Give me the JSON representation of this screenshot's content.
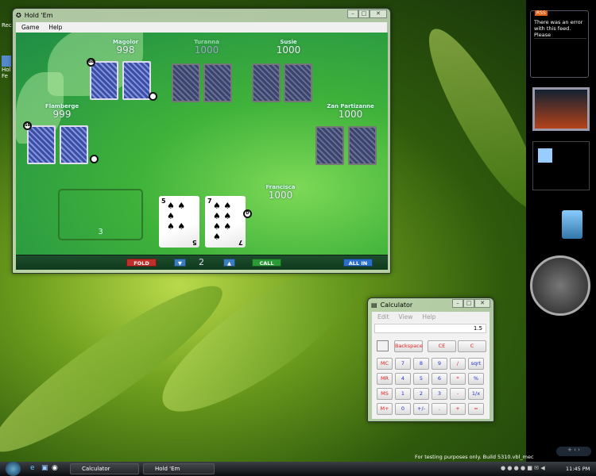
{
  "desktop": {
    "icons": [
      {
        "label": "Rec"
      },
      {
        "label": "Hol Fe"
      }
    ],
    "watermark": "For testing purposes only. Build 5310.vbl_mec"
  },
  "holdem": {
    "title": "Hold 'Em",
    "menu": [
      "Game",
      "Help"
    ],
    "players": [
      {
        "name": "Magolor",
        "chips": "998",
        "chip": "BB"
      },
      {
        "name": "Turanna",
        "chips": "1000"
      },
      {
        "name": "Susie",
        "chips": "1000"
      },
      {
        "name": "Flamberge",
        "chips": "999",
        "chip": "SB"
      },
      {
        "name": "Zan Partizanne",
        "chips": "1000"
      },
      {
        "name": "Francisca",
        "chips": "1000",
        "chip": "D"
      }
    ],
    "pot": "3",
    "hand": [
      {
        "rank": "5",
        "suit": "♠"
      },
      {
        "rank": "7",
        "suit": "♠"
      }
    ],
    "controls": {
      "fold": "FOLD",
      "bet": "2",
      "call": "CALL",
      "allin": "ALL IN"
    }
  },
  "calculator": {
    "title": "Calculator",
    "menu": [
      "Edit",
      "View",
      "Help"
    ],
    "display": "1.5",
    "top": [
      "Backspace",
      "CE",
      "C"
    ],
    "mem": [
      "MC",
      "MR",
      "MS",
      "M+"
    ],
    "rows": [
      [
        "7",
        "8",
        "9",
        "/",
        "sqrt"
      ],
      [
        "4",
        "5",
        "6",
        "*",
        "%"
      ],
      [
        "1",
        "2",
        "3",
        "-",
        "1/x"
      ],
      [
        "0",
        "+/-",
        ".",
        "+",
        "="
      ]
    ]
  },
  "sidebar": {
    "rss_badge": "RSS",
    "rss_text": "There was an error with this feed. Please"
  },
  "taskbar": {
    "items": [
      "Calculator",
      "Hold 'Em"
    ],
    "clock": "11:45 PM"
  }
}
